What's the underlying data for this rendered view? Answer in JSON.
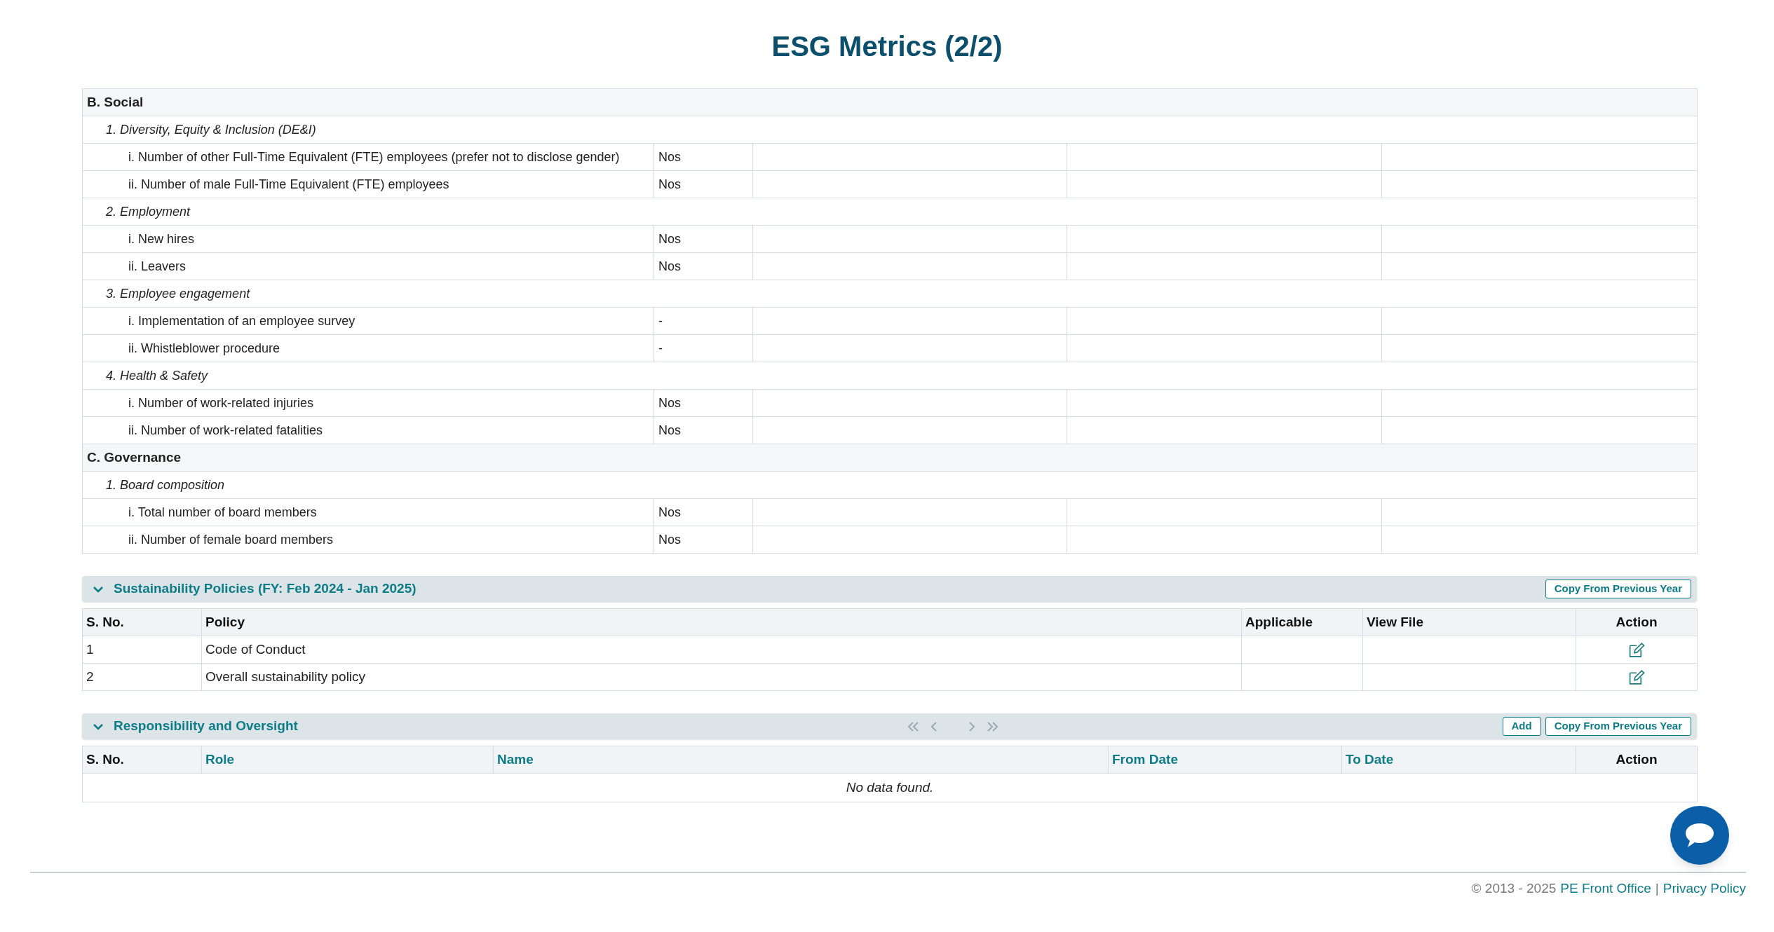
{
  "title": "ESG Metrics (2/2)",
  "metrics": [
    {
      "label": "B. Social",
      "groups": [
        {
          "label": "1. Diversity, Equity & Inclusion (DE&I)",
          "items": [
            {
              "label": "i. Number of other Full-Time Equivalent (FTE) employees (prefer not to disclose gender)",
              "unit": "Nos"
            },
            {
              "label": "ii. Number of male Full-Time Equivalent (FTE) employees",
              "unit": "Nos"
            }
          ]
        },
        {
          "label": "2. Employment",
          "items": [
            {
              "label": "i. New hires",
              "unit": "Nos"
            },
            {
              "label": "ii. Leavers",
              "unit": "Nos"
            }
          ]
        },
        {
          "label": "3. Employee engagement",
          "items": [
            {
              "label": "i. Implementation of an employee survey",
              "unit": "-"
            },
            {
              "label": "ii. Whistleblower procedure",
              "unit": "-"
            }
          ]
        },
        {
          "label": "4. Health & Safety",
          "items": [
            {
              "label": "i. Number of work-related injuries",
              "unit": "Nos"
            },
            {
              "label": "ii. Number of work-related fatalities",
              "unit": "Nos"
            }
          ]
        }
      ]
    },
    {
      "label": "C. Governance",
      "groups": [
        {
          "label": "1. Board composition",
          "items": [
            {
              "label": "i. Total number of board members",
              "unit": "Nos"
            },
            {
              "label": "ii. Number of female board members",
              "unit": "Nos"
            }
          ]
        }
      ]
    }
  ],
  "policies": {
    "title": "Sustainability Policies (FY: Feb 2024 - Jan 2025)",
    "expanded": true,
    "buttons": [
      "Copy From Previous Year"
    ],
    "columns": [
      {
        "label": "S. No.",
        "sortable": false
      },
      {
        "label": "Policy",
        "sortable": false
      },
      {
        "label": "Applicable",
        "sortable": false
      },
      {
        "label": "View File",
        "sortable": false
      },
      {
        "label": "Action",
        "sortable": false
      }
    ],
    "rows": [
      {
        "s_no": "1",
        "policy": "Code of Conduct"
      },
      {
        "s_no": "2",
        "policy": "Overall sustainability policy"
      }
    ]
  },
  "responsibility": {
    "title": "Responsibility and Oversight",
    "expanded": true,
    "buttons": [
      "Add",
      "Copy From Previous Year"
    ],
    "columns": [
      {
        "label": "S. No.",
        "sortable": false
      },
      {
        "label": "Role",
        "sortable": true
      },
      {
        "label": "Name",
        "sortable": true
      },
      {
        "label": "From Date",
        "sortable": true
      },
      {
        "label": "To Date",
        "sortable": true
      },
      {
        "label": "Action",
        "sortable": false
      }
    ],
    "empty_message": "No data found."
  },
  "footer": {
    "copyright": "© 2013 - 2025",
    "company": "PE Front Office",
    "separator": "|",
    "privacy": "Privacy Policy"
  }
}
